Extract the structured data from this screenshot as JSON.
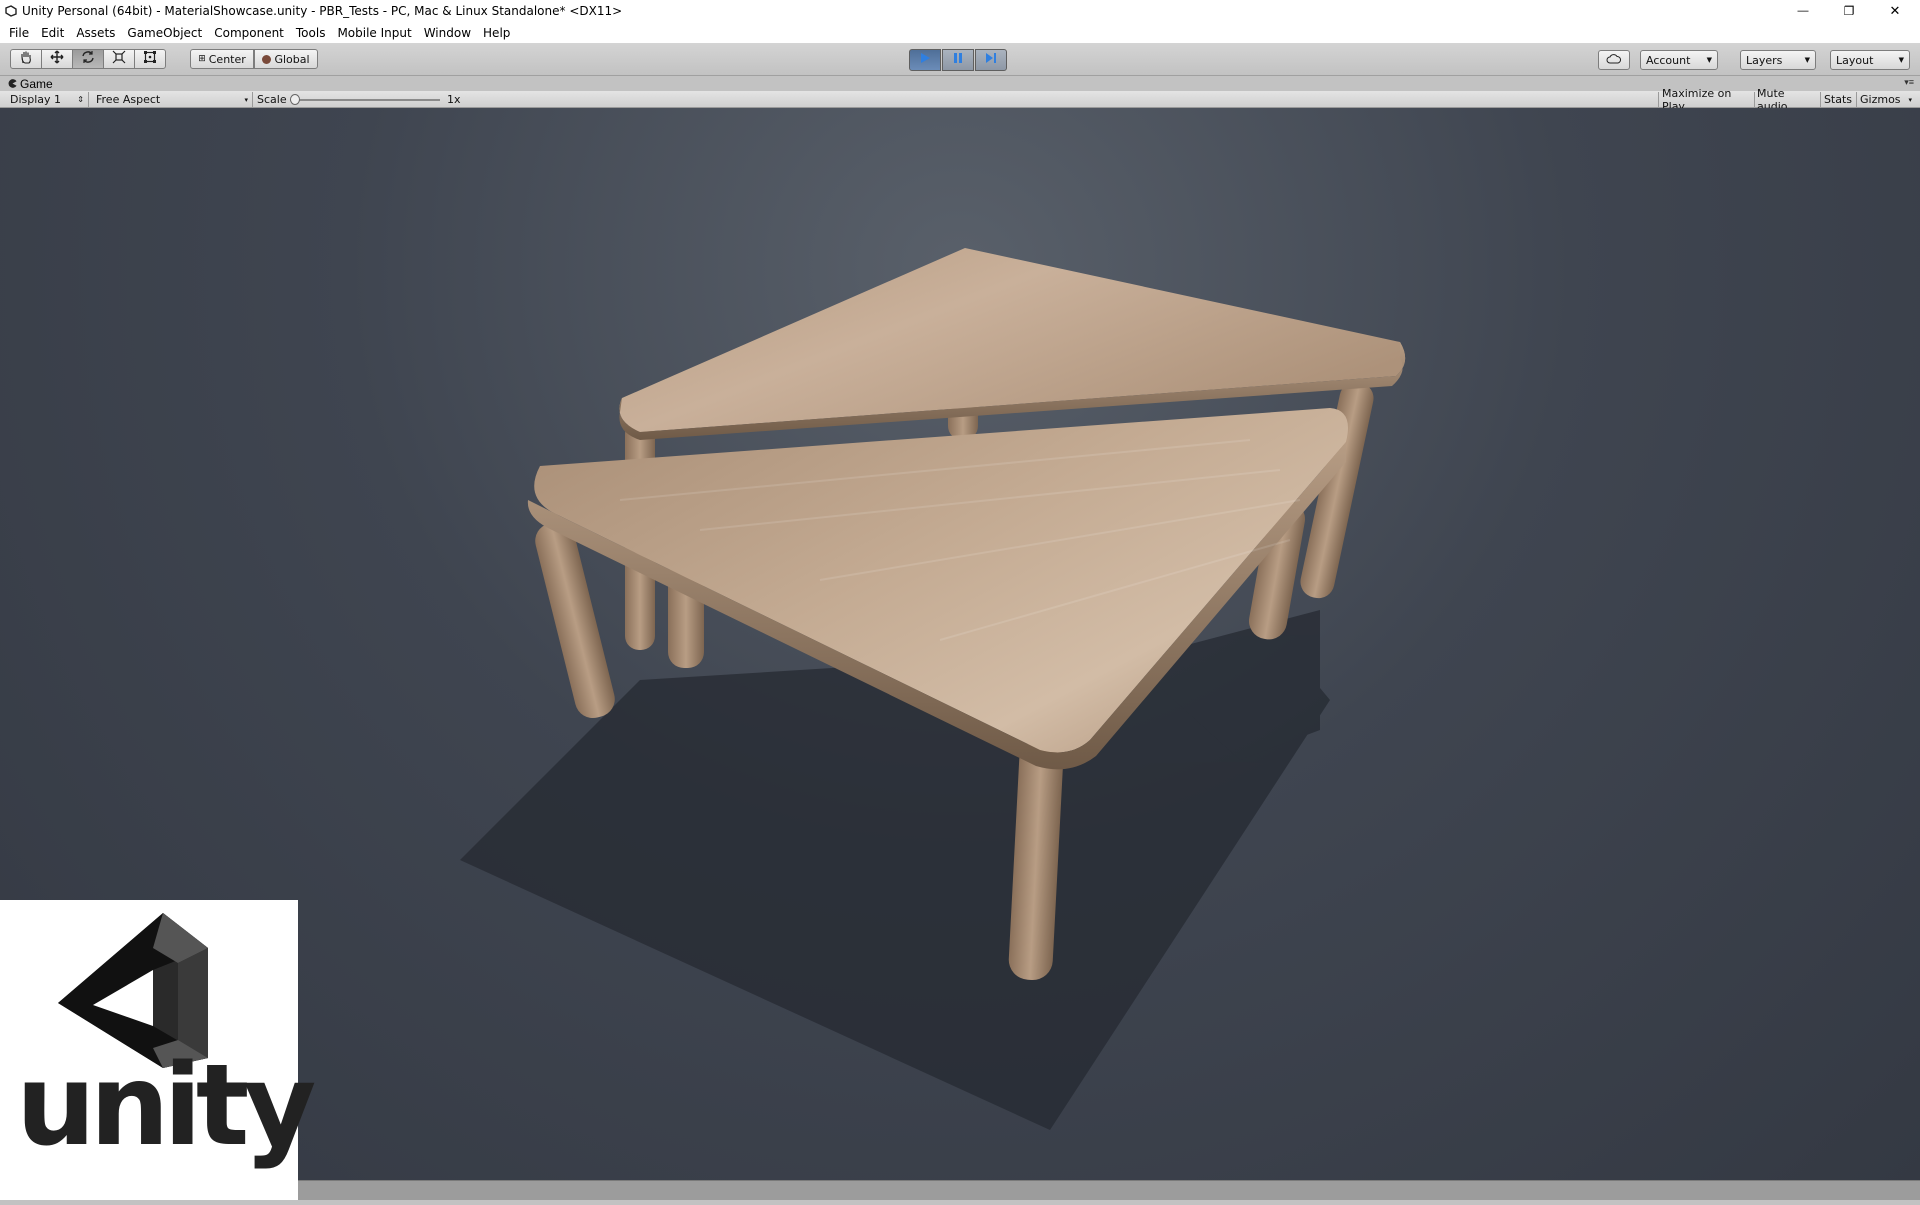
{
  "window": {
    "title": "Unity Personal (64bit) - MaterialShowcase.unity - PBR_Tests - PC, Mac & Linux Standalone* <DX11>",
    "controls": {
      "minimize": "—",
      "restore": "❐",
      "close": "✕"
    }
  },
  "menu": [
    "File",
    "Edit",
    "Assets",
    "GameObject",
    "Component",
    "Tools",
    "Mobile Input",
    "Window",
    "Help"
  ],
  "toolbar": {
    "transform_tools": [
      "hand-icon",
      "move-icon",
      "rotate-icon",
      "scale-icon",
      "rect-tool-icon"
    ],
    "active_tool": "rotate-icon",
    "pivot_label": "Center",
    "space_label": "Global",
    "playback": {
      "play_active": true
    },
    "account_label": "Account",
    "layers_label": "Layers",
    "layout_label": "Layout"
  },
  "game_view": {
    "tab_label": "Game",
    "display": "Display 1",
    "aspect": "Free Aspect",
    "scale_label": "Scale",
    "scale_value": "1x",
    "maximize_label": "Maximize on Play",
    "mute_label": "Mute audio",
    "stats_label": "Stats",
    "gizmos_label": "Gizmos"
  },
  "logo": {
    "wordmark": "unity"
  },
  "colors": {
    "accent_play": "#5a7fb0",
    "viewport_bg": "#3f4550",
    "wood_light": "#c7ac92",
    "wood_dark": "#8e765f"
  }
}
